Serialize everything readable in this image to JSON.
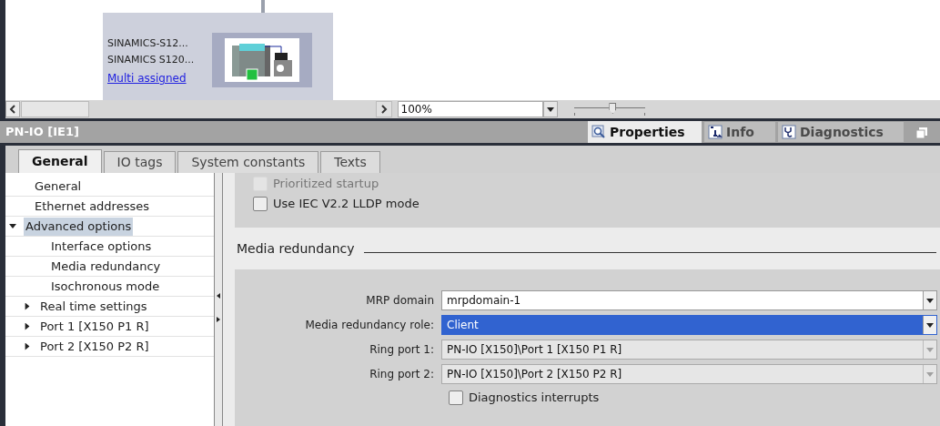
{
  "canvas": {
    "device": {
      "lines": [
        "SINAMICS-S12...",
        "SINAMICS S120..."
      ],
      "link": "Multi assigned"
    }
  },
  "toolbar": {
    "zoom": "100%",
    "zoom_slider": {
      "level": 0.55
    }
  },
  "inspector": {
    "title": "PN-IO [IE1]",
    "view_tabs": [
      {
        "label": "Properties",
        "kind": "properties",
        "selected": true
      },
      {
        "label": "Info",
        "kind": "info",
        "selected": false
      },
      {
        "label": "Diagnostics",
        "kind": "diagnostics",
        "selected": false
      }
    ],
    "tabs": [
      {
        "label": "General",
        "selected": true
      },
      {
        "label": "IO tags",
        "selected": false
      },
      {
        "label": "System constants",
        "selected": false
      },
      {
        "label": "Texts",
        "selected": false
      }
    ],
    "nav": [
      {
        "label": "General",
        "selected": false
      },
      {
        "label": "Ethernet addresses",
        "selected": false
      },
      {
        "label": "Advanced options",
        "selected": true,
        "expanded": true,
        "children": [
          {
            "label": "Interface options",
            "selected": false
          },
          {
            "label": "Media redundancy",
            "selected": false
          },
          {
            "label": "Isochronous mode",
            "selected": false
          },
          {
            "label": "Real time settings",
            "selected": false,
            "expanded": false
          },
          {
            "label": "Port 1 [X150 P1 R]",
            "selected": false,
            "expanded": false
          },
          {
            "label": "Port 2 [X150 P2 R]",
            "selected": false,
            "expanded": false
          }
        ]
      }
    ],
    "options": [
      {
        "label": "Prioritized startup",
        "checked": false,
        "disabled": true
      },
      {
        "label": "Use IEC V2.2 LLDP mode",
        "checked": false,
        "disabled": false
      }
    ],
    "section": "Media redundancy",
    "fields": [
      {
        "label": "MRP domain",
        "value": "mrpdomain-1",
        "selected": false,
        "disabled": false
      },
      {
        "label": "Media redundancy role:",
        "value": "Client",
        "selected": true,
        "disabled": false
      },
      {
        "label": "Ring port 1:",
        "value": "PN-IO [X150]\\Port 1 [X150 P1 R]",
        "selected": false,
        "disabled": true
      },
      {
        "label": "Ring port 2:",
        "value": "PN-IO [X150]\\Port 2 [X150 P2 R]",
        "selected": false,
        "disabled": true
      }
    ],
    "diagnostics_interrupts": {
      "label": "Diagnostics interrupts",
      "checked": false
    }
  }
}
